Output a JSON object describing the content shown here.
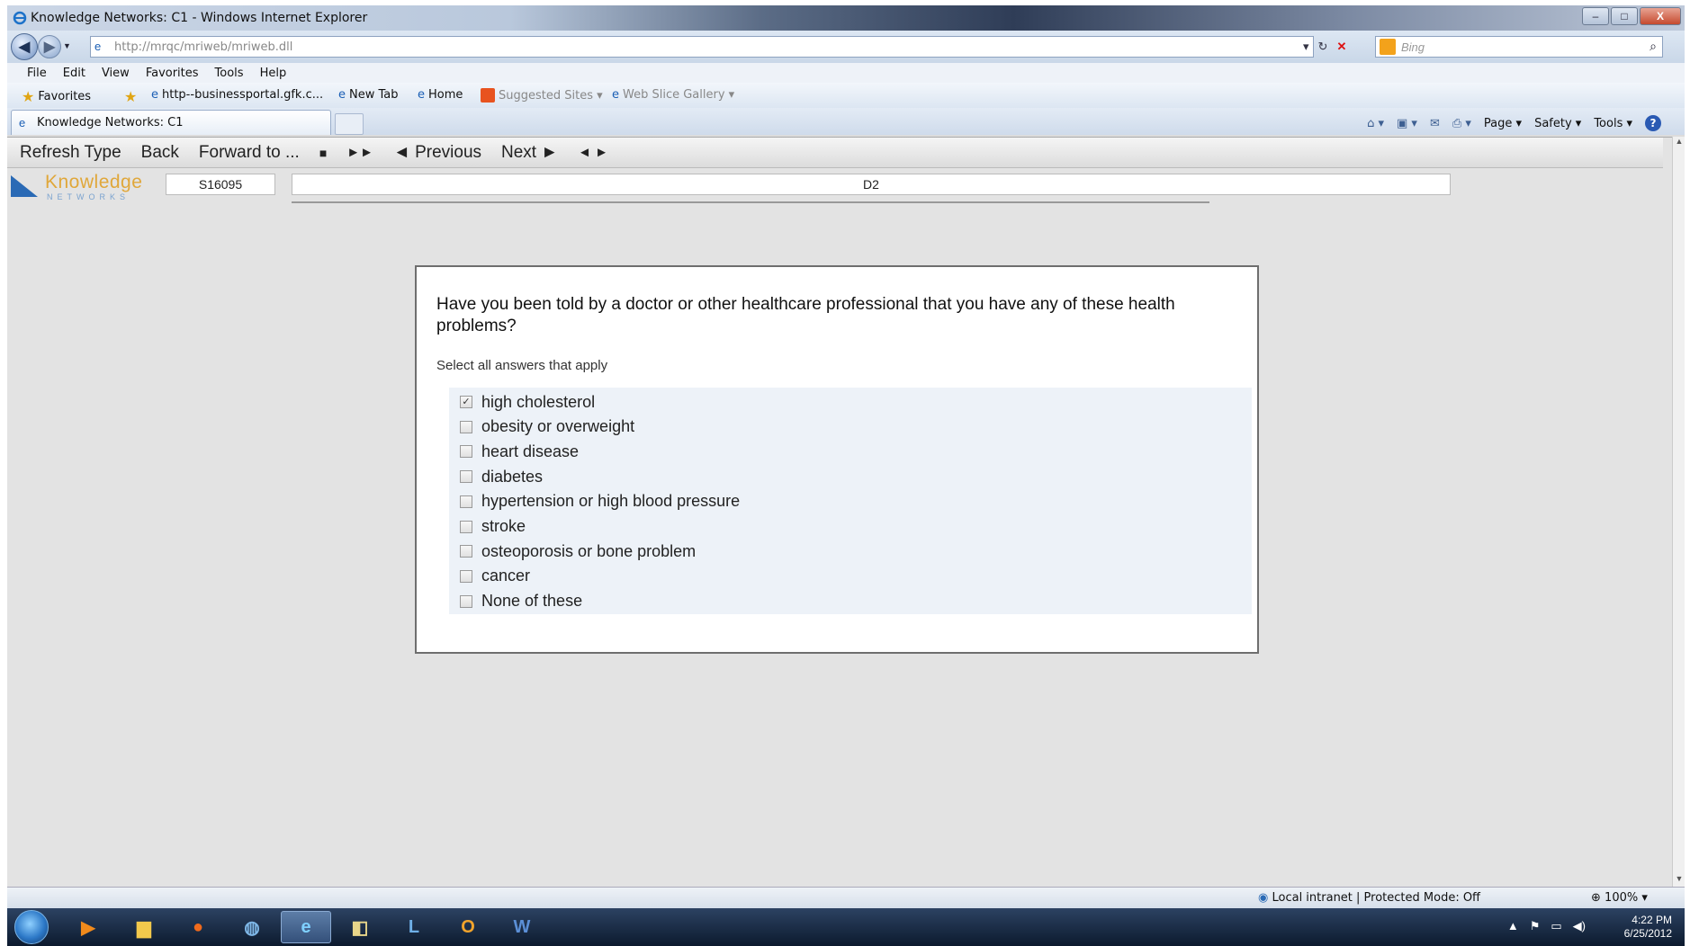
{
  "window": {
    "title": "Knowledge Networks: C1 - Windows Internet Explorer",
    "controls": {
      "minimize": "–",
      "maximize": "□",
      "close": "X"
    }
  },
  "address_bar": {
    "url": "http://mrqc/mriweb/mriweb.dll",
    "search_placeholder": "Bing"
  },
  "menu": [
    "File",
    "Edit",
    "View",
    "Favorites",
    "Tools",
    "Help"
  ],
  "favorites_bar": {
    "favorites_label": "Favorites",
    "items": [
      "http--businessportal.gfk.c...",
      "New Tab",
      "Home",
      "Suggested Sites ▾",
      "Web Slice Gallery ▾"
    ]
  },
  "tab": {
    "label": "Knowledge Networks: C1"
  },
  "command_bar": {
    "page": "Page ▾",
    "safety": "Safety ▾",
    "tools": "Tools ▾",
    "help": "?"
  },
  "survey_toolbar": {
    "refresh_type": "Refresh Type",
    "back": "Back",
    "forward_to": "Forward to ...",
    "stop": "■",
    "fast_forward": "►►",
    "previous": "◄ Previous",
    "next": "Next ►",
    "toggle": "◄ ►"
  },
  "logo": {
    "word": "Knowledge",
    "sub": "NETWORKS"
  },
  "question_header": {
    "id": "S16095",
    "name": "D2"
  },
  "question": {
    "text": "Have you been told by a doctor or other healthcare professional that you have any of these health problems?",
    "instruction": "Select all answers that apply",
    "options": [
      {
        "label": "high cholesterol",
        "checked": true
      },
      {
        "label": "obesity or overweight",
        "checked": false
      },
      {
        "label": "heart disease",
        "checked": false
      },
      {
        "label": "diabetes",
        "checked": false
      },
      {
        "label": "hypertension or high blood pressure",
        "checked": false
      },
      {
        "label": "stroke",
        "checked": false
      },
      {
        "label": "osteoporosis or bone problem",
        "checked": false
      },
      {
        "label": "cancer",
        "checked": false
      },
      {
        "label": "None of these",
        "checked": false
      }
    ]
  },
  "status_bar": {
    "zone": "Local intranet | Protected Mode: Off",
    "zoom": "100%"
  },
  "taskbar": {
    "time": "4:22 PM",
    "date": "6/25/2012",
    "apps": [
      "media-player-icon",
      "explorer-icon",
      "firefox-icon",
      "network-icon",
      "internet-explorer-icon",
      "folder-icon",
      "lync-icon",
      "outlook-icon",
      "word-icon"
    ]
  }
}
